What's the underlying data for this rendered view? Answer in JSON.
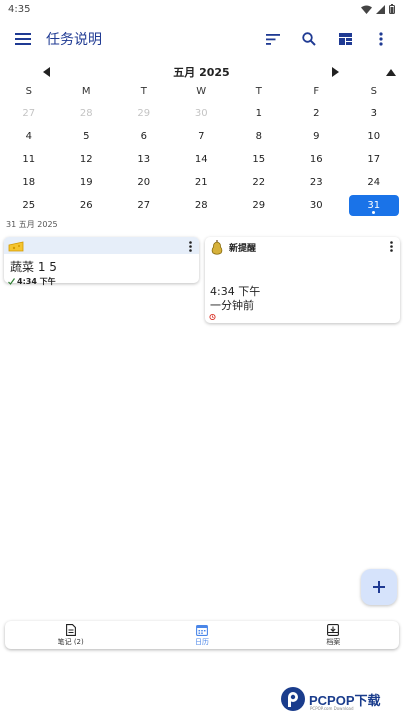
{
  "status_bar": {
    "time": "4:35"
  },
  "app_bar": {
    "title": "任务说明",
    "icons": [
      "menu-icon",
      "sort-icon",
      "search-icon",
      "layout-icon",
      "more-vert-icon"
    ]
  },
  "calendar": {
    "month_label": "五月 2025",
    "weekdays": [
      "S",
      "M",
      "T",
      "W",
      "T",
      "F",
      "S"
    ],
    "days": [
      {
        "d": "27",
        "muted": true
      },
      {
        "d": "28",
        "muted": true
      },
      {
        "d": "29",
        "muted": true
      },
      {
        "d": "30",
        "muted": true
      },
      {
        "d": "1"
      },
      {
        "d": "2"
      },
      {
        "d": "3"
      },
      {
        "d": "4"
      },
      {
        "d": "5"
      },
      {
        "d": "6"
      },
      {
        "d": "7"
      },
      {
        "d": "8"
      },
      {
        "d": "9"
      },
      {
        "d": "10"
      },
      {
        "d": "11"
      },
      {
        "d": "12"
      },
      {
        "d": "13"
      },
      {
        "d": "14"
      },
      {
        "d": "15"
      },
      {
        "d": "16"
      },
      {
        "d": "17"
      },
      {
        "d": "18"
      },
      {
        "d": "19"
      },
      {
        "d": "20"
      },
      {
        "d": "21"
      },
      {
        "d": "22"
      },
      {
        "d": "23"
      },
      {
        "d": "24"
      },
      {
        "d": "25"
      },
      {
        "d": "26"
      },
      {
        "d": "27"
      },
      {
        "d": "28"
      },
      {
        "d": "29"
      },
      {
        "d": "30"
      },
      {
        "d": "31",
        "selected": true
      }
    ],
    "selected_color": "#1a73e8"
  },
  "selected_date_label": "31 五月 2025",
  "notes": [
    {
      "title": "蔬菜 1 5",
      "time": "4:34 下午",
      "icon": "cheese-icon",
      "header_color": "#e6eef9"
    },
    {
      "title": "新提醒",
      "time": "4:34 下午",
      "relative": "一分钟前",
      "icon": "pear-icon"
    }
  ],
  "bottom_nav": [
    {
      "label": "笔记 (2)",
      "icon": "note-icon"
    },
    {
      "label": "日历",
      "icon": "calendar-icon",
      "active": true
    },
    {
      "label": "档案",
      "icon": "archive-icon"
    }
  ],
  "watermark": {
    "text": "PCPOP下载",
    "sub": "PCPOP.com Download"
  }
}
